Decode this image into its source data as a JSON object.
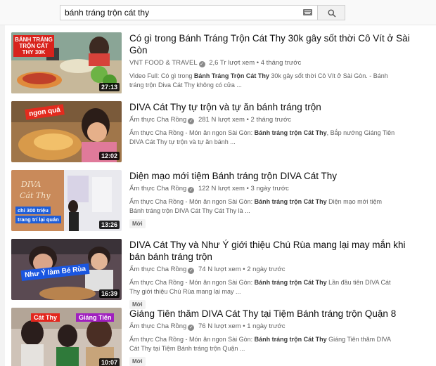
{
  "search": {
    "query": "bánh tráng trộn cát thy"
  },
  "results": [
    {
      "title": "Có gì trong Bánh Tráng Trộn Cát Thy 30k gây sốt thời Cô Vít ở Sài Gòn",
      "channel": "VNT FOOD & TRAVEL",
      "views": "2,6 Tr lượt xem",
      "age": "4 tháng trước",
      "desc_pre": "Video Full: Có gì trong ",
      "desc_bold": "Bánh Tráng Trộn Cát Thy",
      "desc_post": " 30k gây sốt thời Cô Vít ở Sài Gòn. - Bánh tráng trộn Diva Cát Thy không có cửa ...",
      "duration": "27:13",
      "thumb_text": "BÁNH TRÁNG TRỘN CÁT THY 30K",
      "badge": ""
    },
    {
      "title": "DIVA Cát Thy tự trộn và tự ăn bánh tráng trộn",
      "channel": "Ẩm thực Cha Rồng",
      "views": "281 N lượt xem",
      "age": "2 tháng trước",
      "desc_pre": "Ẩm thực Cha Rồng - Món ăn ngon Sài Gòn: ",
      "desc_bold": "Bánh tráng trộn Cát Thy",
      "desc_post": ", Bắp nướng Giáng Tiên DIVA Cát Thy tự trộn và tự ăn bánh ...",
      "duration": "12:02",
      "thumb_text": "ngon quá",
      "badge": ""
    },
    {
      "title": "Diện mạo mới tiệm Bánh tráng trộn DIVA Cát Thy",
      "channel": "Ẩm thực Cha Rồng",
      "views": "122 N lượt xem",
      "age": "3 ngày trước",
      "desc_pre": "Ẩm thực Cha Rồng - Món ăn ngon Sài Gòn: ",
      "desc_bold": "Bánh tráng trộn Cát Thy",
      "desc_post": " Diện mạo mới tiệm Bánh tráng trộn DIVA Cát Thy Cát Thy là ...",
      "duration": "13:26",
      "thumb_text": "chỉ 300 triệu",
      "thumb_text2": "trang trí lại quán",
      "badge": "Mới"
    },
    {
      "title": "DIVA Cát Thy và Như Ý giới thiệu Chú Rùa mang lại may mắn khi bán bánh tráng trộn",
      "channel": "Ẩm thực Cha Rồng",
      "views": "74 N lượt xem",
      "age": "2 ngày trước",
      "desc_pre": "Ẩm thực Cha Rồng - Món ăn ngon Sài Gòn: ",
      "desc_bold": "Bánh tráng trộn Cát Thy",
      "desc_post": " Lần đầu tiên DIVA Cát Thy giới thiệu Chú Rùa mang lại may ...",
      "duration": "16:39",
      "thumb_text": "Như Ý làm Bé Rùa",
      "badge": "Mới"
    },
    {
      "title": "Giáng Tiên thăm DIVA Cát Thy tại Tiệm Bánh tráng trộn Quận 8",
      "channel": "Ẩm thực Cha Rồng",
      "views": "76 N lượt xem",
      "age": "1 ngày trước",
      "desc_pre": "Ẩm thực Cha Rồng - Món ăn ngon Sài Gòn: ",
      "desc_bold": "Bánh tráng trộn Cát Thy",
      "desc_post": " Giáng Tiên thăm DIVA Cát Thy tại Tiệm Bánh tráng trộn Quận ...",
      "duration": "10:07",
      "thumb_text": "Cát Thy",
      "thumb_text2": "Giáng Tiên",
      "badge": "Mới"
    }
  ]
}
